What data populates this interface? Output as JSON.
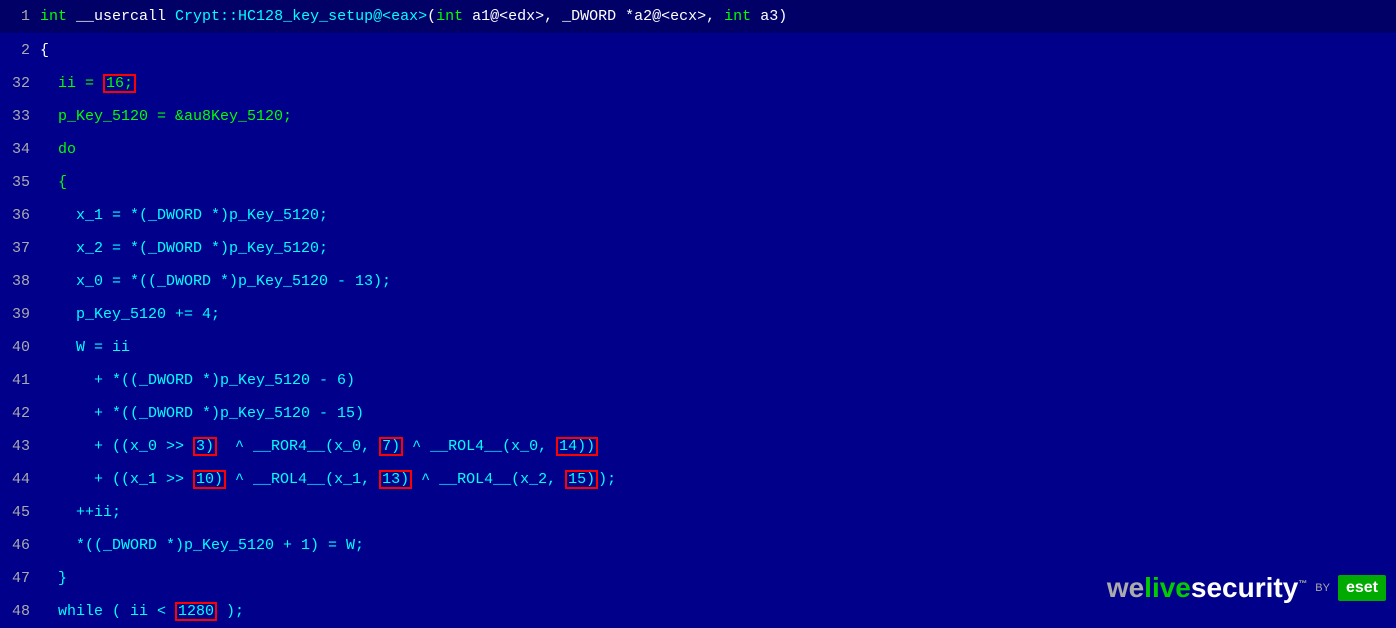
{
  "lines": [
    {
      "number": "1",
      "isHeader": true,
      "parts": [
        {
          "text": "int",
          "class": "kw"
        },
        {
          "text": " __usercall ",
          "class": "white"
        },
        {
          "text": "Crypt::HC128_key_setup@<eax>",
          "class": "cyan"
        },
        {
          "text": "(",
          "class": "white"
        },
        {
          "text": "int",
          "class": "kw"
        },
        {
          "text": " a1@<edx>, _DWORD *a2@<ecx>, ",
          "class": "white"
        },
        {
          "text": "int",
          "class": "kw"
        },
        {
          "text": " a3)",
          "class": "white"
        }
      ]
    },
    {
      "number": "2",
      "isHeader": false,
      "parts": [
        {
          "text": "{",
          "class": "white"
        }
      ]
    },
    {
      "number": "32",
      "parts": [
        {
          "text": "  ii = ",
          "class": "green"
        },
        {
          "text": "16;",
          "class": "green",
          "boxed": true
        }
      ]
    },
    {
      "number": "33",
      "parts": [
        {
          "text": "  p_Key_5120 = &au8Key_5120;",
          "class": "green"
        }
      ]
    },
    {
      "number": "34",
      "parts": [
        {
          "text": "  do",
          "class": "green"
        }
      ]
    },
    {
      "number": "35",
      "parts": [
        {
          "text": "  {",
          "class": "green"
        }
      ]
    },
    {
      "number": "36",
      "parts": [
        {
          "text": "    x_1 = *(_DWORD *)p_Key_5120;",
          "class": "cyan"
        }
      ]
    },
    {
      "number": "37",
      "parts": [
        {
          "text": "    x_2 = *(_DWORD *)p_Key_5120;",
          "class": "cyan"
        }
      ]
    },
    {
      "number": "38",
      "parts": [
        {
          "text": "    x_0 = *((_DWORD *)p_Key_5120 - 13);",
          "class": "cyan"
        }
      ]
    },
    {
      "number": "39",
      "parts": [
        {
          "text": "    p_Key_5120 += 4;",
          "class": "cyan"
        }
      ]
    },
    {
      "number": "40",
      "parts": [
        {
          "text": "    W = ii",
          "class": "cyan"
        }
      ]
    },
    {
      "number": "41",
      "parts": [
        {
          "text": "      + *((_DWORD *)p_Key_5120 - 6)",
          "class": "cyan"
        }
      ]
    },
    {
      "number": "42",
      "parts": [
        {
          "text": "      + *((_DWORD *)p_Key_5120 - 15)",
          "class": "cyan"
        }
      ]
    },
    {
      "number": "43",
      "parts": [
        {
          "text": "      + ((x_0 >> ",
          "class": "cyan"
        },
        {
          "text": "3)",
          "class": "cyan",
          "boxed": true
        },
        {
          "text": "  ^ __ROR4__(x_0, ",
          "class": "cyan"
        },
        {
          "text": "7)",
          "class": "cyan",
          "boxed": true
        },
        {
          "text": " ^ __ROL4__(x_0, ",
          "class": "cyan"
        },
        {
          "text": "14))",
          "class": "cyan",
          "boxed": true
        }
      ]
    },
    {
      "number": "44",
      "parts": [
        {
          "text": "      + ((x_1 >> ",
          "class": "cyan"
        },
        {
          "text": "10)",
          "class": "cyan",
          "boxed": true
        },
        {
          "text": " ^ __ROL4__(x_1, ",
          "class": "cyan"
        },
        {
          "text": "13)",
          "class": "cyan",
          "boxed": true
        },
        {
          "text": " ^ __ROL4__(x_2, ",
          "class": "cyan"
        },
        {
          "text": "15)",
          "class": "cyan",
          "boxed": true
        },
        {
          "text": ");",
          "class": "cyan"
        }
      ]
    },
    {
      "number": "45",
      "parts": [
        {
          "text": "    ++ii;",
          "class": "cyan"
        }
      ]
    },
    {
      "number": "46",
      "parts": [
        {
          "text": "    *((_DWORD *)p_Key_5120 + 1) = W;",
          "class": "cyan"
        }
      ]
    },
    {
      "number": "47",
      "parts": [
        {
          "text": "  }",
          "class": "cyan"
        }
      ]
    },
    {
      "number": "48",
      "parts": [
        {
          "text": "  while ( ii < ",
          "class": "cyan"
        },
        {
          "text": "1280",
          "class": "cyan",
          "boxed": true
        },
        {
          "text": " );",
          "class": "cyan"
        }
      ]
    }
  ],
  "logo": {
    "we": "we",
    "live": "live",
    "security": "security",
    "tm": "™",
    "by": "BY",
    "eset": "eset"
  }
}
